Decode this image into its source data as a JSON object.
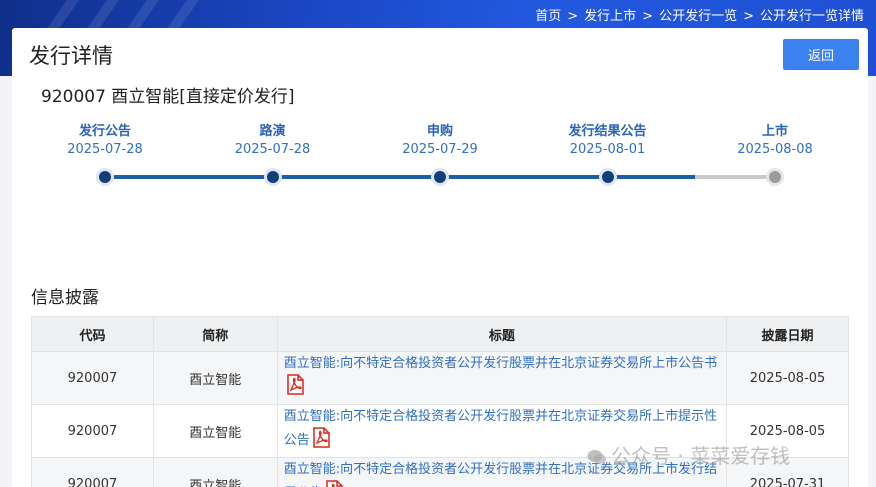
{
  "breadcrumb": [
    "首页",
    "发行上市",
    "公开发行一览",
    "公开发行一览详情"
  ],
  "breadcrumb_sep": ">",
  "page_title": "发行详情",
  "back_button": "返回",
  "stock_title": "920007 酉立智能[直接定价发行]",
  "timeline": {
    "progress_percent": 88,
    "steps": [
      {
        "label": "发行公告",
        "date": "2025-07-28",
        "status": "done"
      },
      {
        "label": "路演",
        "date": "2025-07-28",
        "status": "done"
      },
      {
        "label": "申购",
        "date": "2025-07-29",
        "status": "done"
      },
      {
        "label": "发行结果公告",
        "date": "2025-08-01",
        "status": "done"
      },
      {
        "label": "上市",
        "date": "2025-08-08",
        "status": "pending"
      }
    ]
  },
  "disclosure": {
    "section_title": "信息披露",
    "columns": [
      "代码",
      "简称",
      "标题",
      "披露日期"
    ],
    "rows": [
      {
        "code": "920007",
        "name": "酉立智能",
        "title": "酉立智能:向不特定合格投资者公开发行股票并在北京证券交易所上市公告书",
        "date": "2025-08-05"
      },
      {
        "code": "920007",
        "name": "酉立智能",
        "title": "酉立智能:向不特定合格投资者公开发行股票并在北京证券交易所上市提示性公告",
        "date": "2025-08-05"
      },
      {
        "code": "920007",
        "name": "酉立智能",
        "title": "酉立智能:向不特定合格投资者公开发行股票并在北京证券交易所上市发行结果公告",
        "date": "2025-07-31"
      }
    ]
  },
  "watermark": "公众号 · 菜菜爱存钱",
  "colors": {
    "accent": "#3b82f0",
    "link": "#2f6fc4",
    "track_done": "#1a5fa8",
    "track_todo": "#c9c9c9",
    "pdf_red": "#d9261c"
  }
}
